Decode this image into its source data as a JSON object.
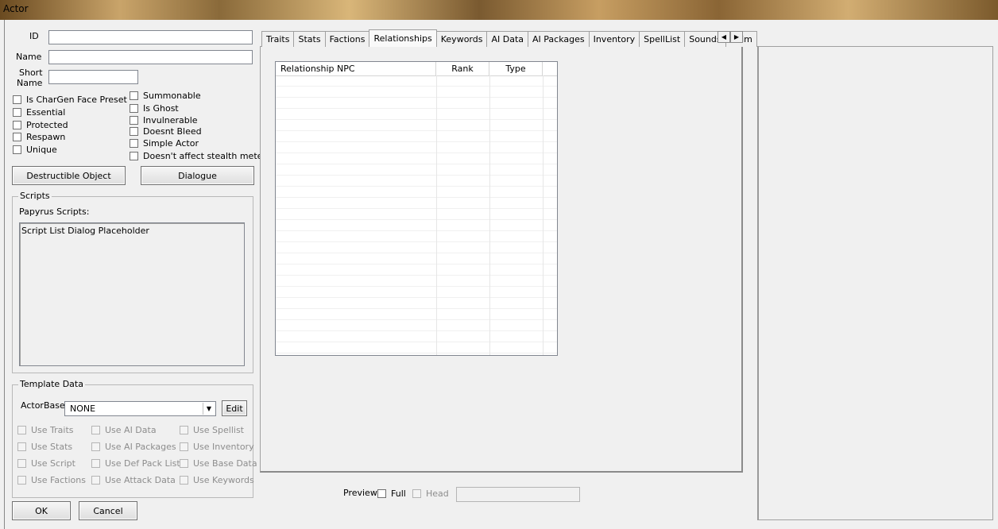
{
  "window": {
    "title": "Actor"
  },
  "fields": {
    "id_label": "ID",
    "id_value": "",
    "name_label": "Name",
    "name_value": "",
    "short_name_label_1": "Short",
    "short_name_label_2": "Name",
    "short_name_value": ""
  },
  "flags_left": [
    {
      "label": "Is CharGen Face Preset",
      "checked": false
    },
    {
      "label": "Essential",
      "checked": false
    },
    {
      "label": "Protected",
      "checked": false
    },
    {
      "label": "Respawn",
      "checked": false
    },
    {
      "label": "Unique",
      "checked": false
    }
  ],
  "flags_right": [
    {
      "label": "Summonable",
      "checked": false
    },
    {
      "label": "Is Ghost",
      "checked": false
    },
    {
      "label": "Invulnerable",
      "checked": false
    },
    {
      "label": "Doesnt Bleed",
      "checked": false
    },
    {
      "label": "Simple Actor",
      "checked": false
    },
    {
      "label": "Doesn't affect stealth meter",
      "checked": false
    }
  ],
  "buttons": {
    "destructible": "Destructible Object",
    "dialogue": "Dialogue",
    "edit": "Edit",
    "ok": "OK",
    "cancel": "Cancel"
  },
  "scripts": {
    "group_label": "Scripts",
    "papyrus_label": "Papyrus Scripts:",
    "list_placeholder": "Script List Dialog Placeholder"
  },
  "template": {
    "group_label": "Template Data",
    "actorbase_label": "ActorBase",
    "actorbase_value": "NONE",
    "col1": [
      "Use Traits",
      "Use Stats",
      "Use Script",
      "Use Factions"
    ],
    "col2": [
      "Use AI Data",
      "Use AI Packages",
      "Use Def Pack List",
      "Use Attack Data"
    ],
    "col3": [
      "Use Spellist",
      "Use Inventory",
      "Use Base Data",
      "Use Keywords"
    ]
  },
  "tabs": [
    {
      "label": "Traits",
      "active": false
    },
    {
      "label": "Stats",
      "active": false
    },
    {
      "label": "Factions",
      "active": false
    },
    {
      "label": "Relationships",
      "active": true
    },
    {
      "label": "Keywords",
      "active": false
    },
    {
      "label": "AI Data",
      "active": false
    },
    {
      "label": "AI Packages",
      "active": false
    },
    {
      "label": "Inventory",
      "active": false
    },
    {
      "label": "SpellList",
      "active": false
    },
    {
      "label": "Sounds",
      "active": false
    },
    {
      "label": "Anim",
      "active": false
    }
  ],
  "relationships": {
    "columns": [
      "Relationship NPC",
      "Rank",
      "Type"
    ],
    "rows": []
  },
  "preview": {
    "label": "Preview",
    "full_label": "Full",
    "head_label": "Head"
  }
}
